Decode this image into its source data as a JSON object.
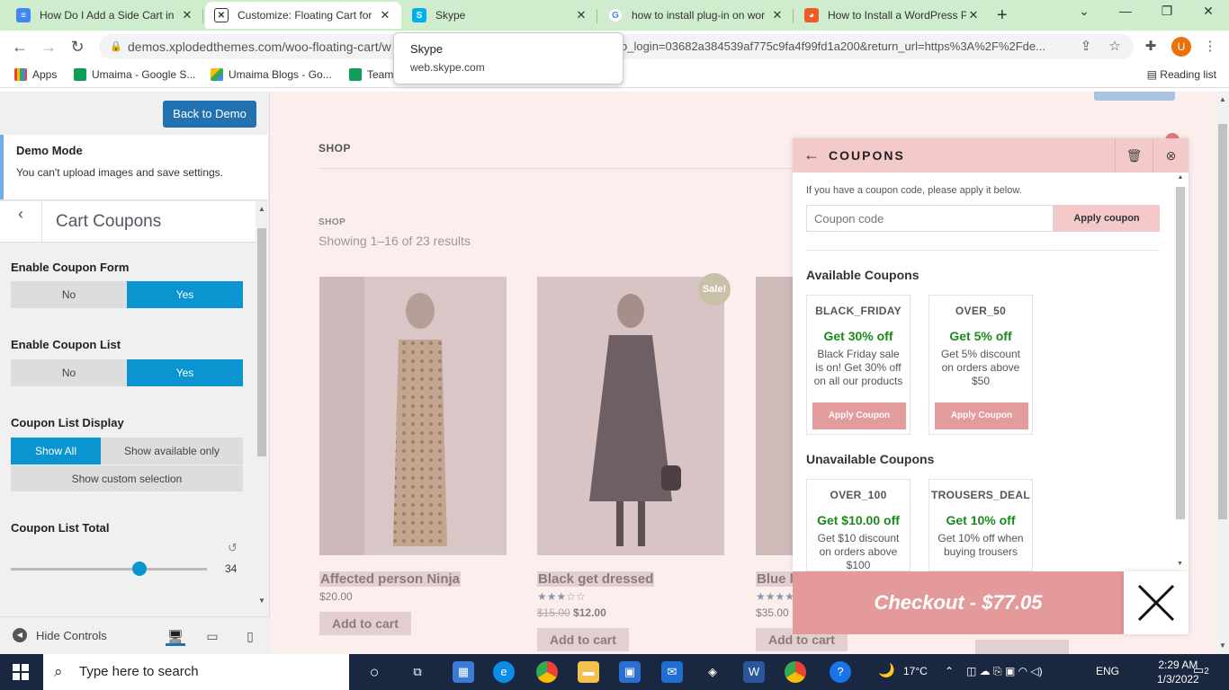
{
  "browser": {
    "tabs": [
      {
        "title": "How Do I Add a Side Cart in",
        "favicon_color": "#4285f4",
        "active": false
      },
      {
        "title": "Customize: Floating Cart for",
        "favicon_color": "#333333",
        "active": true
      },
      {
        "title": "Skype",
        "favicon_color": "#00aff0",
        "active": false
      },
      {
        "title": "how to install plug-in on wor",
        "favicon_color": "#ffffff",
        "active": false
      },
      {
        "title": "How to Install a WordPress P",
        "favicon_color": "#f05a28",
        "active": false
      }
    ],
    "url": "demos.xplodedthemes.com/woo-floating-cart/w",
    "url_tail": "o_login=03682a384539af775c9fa4f99fd1a200&return_url=https%3A%2F%2Fde...",
    "avatar_letter": "U",
    "bookmarks": [
      "Apps",
      "Umaima - Google S...",
      "Umaima Blogs - Go...",
      "Team"
    ],
    "reading_list": "Reading list",
    "tooltip": {
      "title": "Skype",
      "url": "web.skype.com"
    }
  },
  "sidebar": {
    "back_to_demo": "Back to Demo",
    "notice": {
      "title": "Demo Mode",
      "text": "You can't upload images and save settings."
    },
    "section_title": "Cart Coupons",
    "enable_form": {
      "label": "Enable Coupon Form",
      "no": "No",
      "yes": "Yes",
      "value": "Yes"
    },
    "enable_list": {
      "label": "Enable Coupon List",
      "no": "No",
      "yes": "Yes",
      "value": "Yes"
    },
    "list_display": {
      "label": "Coupon List Display",
      "opt1": "Show All",
      "opt2": "Show available only",
      "opt3": "Show custom selection",
      "value": "Show All"
    },
    "list_total": {
      "label": "Coupon List Total",
      "value": "34"
    },
    "hide_controls": "Hide Controls"
  },
  "preview": {
    "nav_shop": "SHOP",
    "breadcrumb": "SHOP",
    "results": "Showing 1–16 of 23 results",
    "sale_badge": "Sale!",
    "products": [
      {
        "name": "Affected person Ninja",
        "price": "$20.00",
        "old_price": "",
        "button": "Add to cart"
      },
      {
        "name": "Black get dressed",
        "price": "$12.00",
        "old_price": "$15.00",
        "button": "Add to cart"
      },
      {
        "name": "Blue b",
        "price": "$35.00",
        "old_price": "",
        "button": "Add to cart"
      }
    ],
    "accent": "#e49a9a"
  },
  "coupons": {
    "title": "COUPONS",
    "hint": "If you have a coupon code, please apply it below.",
    "input_placeholder": "Coupon code",
    "apply_label": "Apply coupon",
    "available_heading": "Available Coupons",
    "unavailable_heading": "Unavailable Coupons",
    "available": [
      {
        "code": "BLACK_FRIDAY",
        "offer": "Get 30% off",
        "desc": "Black Friday sale is on! Get 30% off on all our products",
        "button": "Apply Coupon"
      },
      {
        "code": "OVER_50",
        "offer": "Get 5% off",
        "desc": "Get 5% discount on orders above $50",
        "button": "Apply Coupon"
      }
    ],
    "unavailable": [
      {
        "code": "OVER_100",
        "offer": "Get $10.00 off",
        "desc": "Get $10 discount on orders above $100"
      },
      {
        "code": "TROUSERS_DEAL",
        "offer": "Get 10% off",
        "desc": "Get 10% off when buying trousers"
      }
    ],
    "checkout": "Checkout - $77.05"
  },
  "taskbar": {
    "search_placeholder": "Type here to search",
    "temperature": "17°C",
    "language": "ENG",
    "time": "2:29 AM",
    "date": "1/3/2022",
    "notifications": "2"
  }
}
